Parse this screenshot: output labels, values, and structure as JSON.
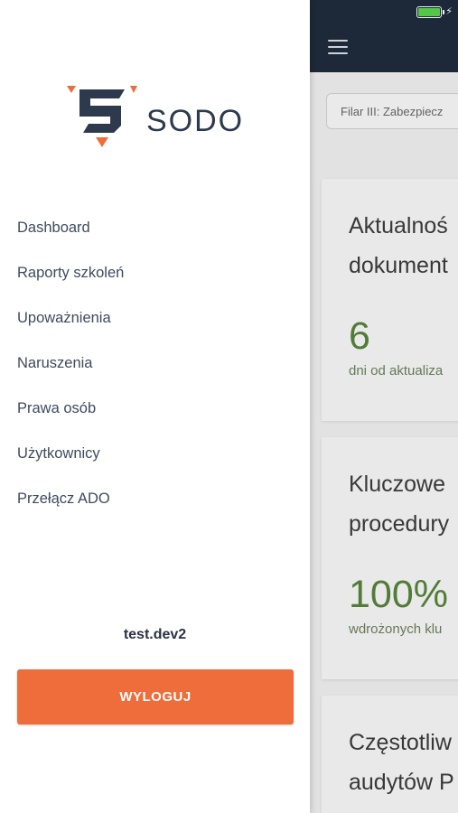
{
  "brand": {
    "name": "SODO",
    "logo_icon": "sodo-logo-icon",
    "accent_color": "#ef6d3a",
    "dark_color": "#2d3a4e"
  },
  "menu": {
    "items": [
      {
        "label": "Dashboard"
      },
      {
        "label": "Raporty szkoleń"
      },
      {
        "label": "Upoważnienia"
      },
      {
        "label": "Naruszenia"
      },
      {
        "label": "Prawa osób"
      },
      {
        "label": "Użytkownicy"
      },
      {
        "label": "Przełącz ADO"
      }
    ]
  },
  "user": {
    "name": "test.dev2"
  },
  "logout_label": "WYLOGUJ",
  "background": {
    "header_color": "#1f2a3c",
    "filter_text": "Filar III: Zabezpiecz",
    "cards": [
      {
        "title_line1": "Aktualnoś",
        "title_line2": "dokument",
        "value": "6",
        "sub": "dni od aktualiza"
      },
      {
        "title_line1": "Kluczowe",
        "title_line2": "procedury",
        "value": "100%",
        "sub": "wdrożonych klu"
      },
      {
        "title_line1": "Częstotliw",
        "title_line2": "audytów P"
      }
    ]
  }
}
